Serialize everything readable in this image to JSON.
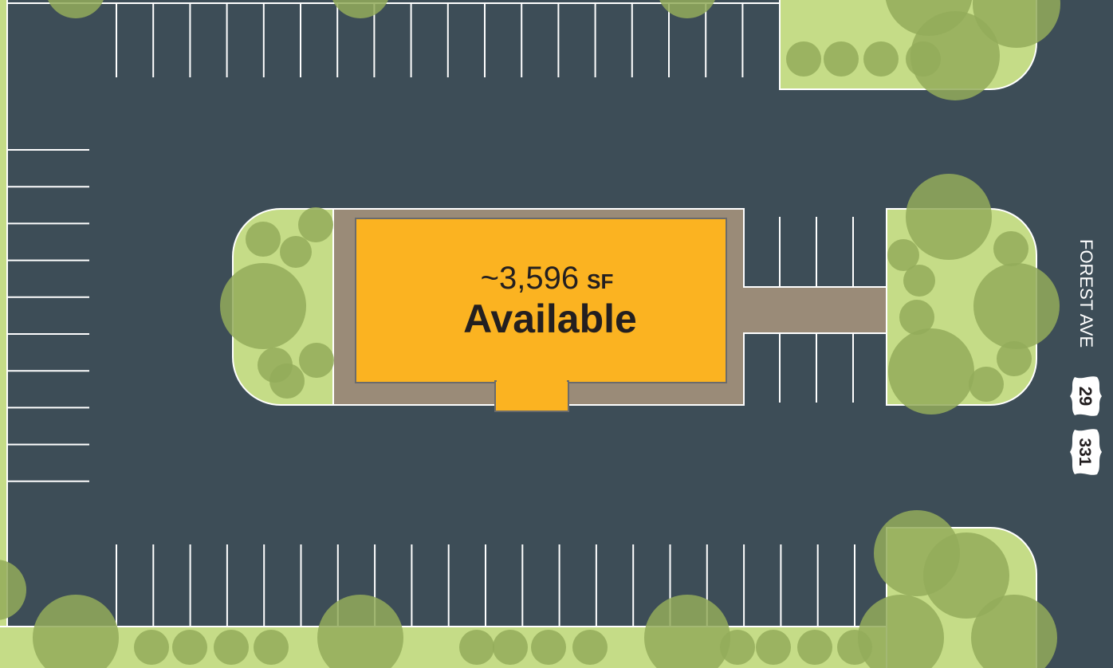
{
  "unit": {
    "size": "~3,596",
    "size_unit": "SF",
    "status": "Available"
  },
  "street": {
    "name": "FOREST AVE",
    "routes": [
      "29",
      "331"
    ]
  },
  "colors": {
    "asphalt": "#3d4d57",
    "landscape": "#c5dc87",
    "tree": "#93ab5a",
    "walkway": "#9a8b78",
    "available_unit": "#fbb321",
    "stripe": "#ffffff"
  }
}
